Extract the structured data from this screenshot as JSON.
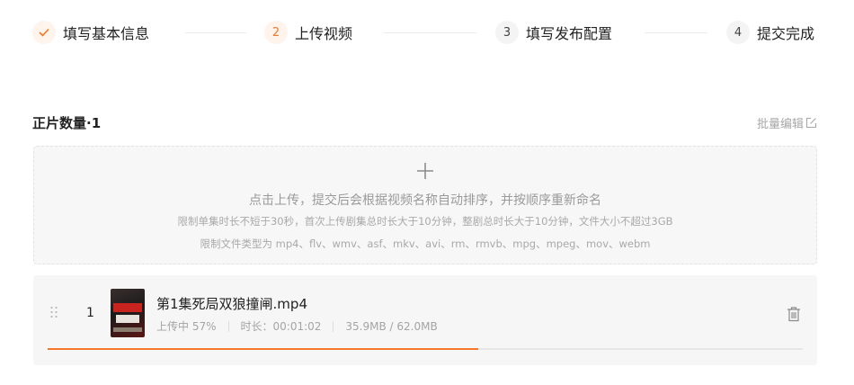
{
  "steps": [
    {
      "number": "",
      "label": "填写基本信息",
      "state": "done"
    },
    {
      "number": "2",
      "label": "上传视频",
      "state": "active"
    },
    {
      "number": "3",
      "label": "填写发布配置",
      "state": "todo"
    },
    {
      "number": "4",
      "label": "提交完成",
      "state": "todo"
    }
  ],
  "section": {
    "title": "正片数量·1",
    "batch_edit_label": "批量编辑"
  },
  "upload": {
    "main_text": "点击上传，提交后会根据视频名称自动排序，并按顺序重新命名",
    "limit_text": "限制单集时长不短于30秒，首次上传剧集总时长大于10分钟，整剧总时长大于10分钟，文件大小不超过3GB",
    "types_text": "限制文件类型为 mp4、flv、wmv、asf、mkv、avi、rm、rmvb、mpg、mpeg、mov、webm"
  },
  "file": {
    "index": "1",
    "name": "第1集死局双狼撞闸.mp4",
    "status": "上传中 57%",
    "duration": "时长：00:01:02",
    "size": "35.9MB / 62.0MB",
    "progress": 0.57
  },
  "colors": {
    "accent": "#f5772a"
  }
}
